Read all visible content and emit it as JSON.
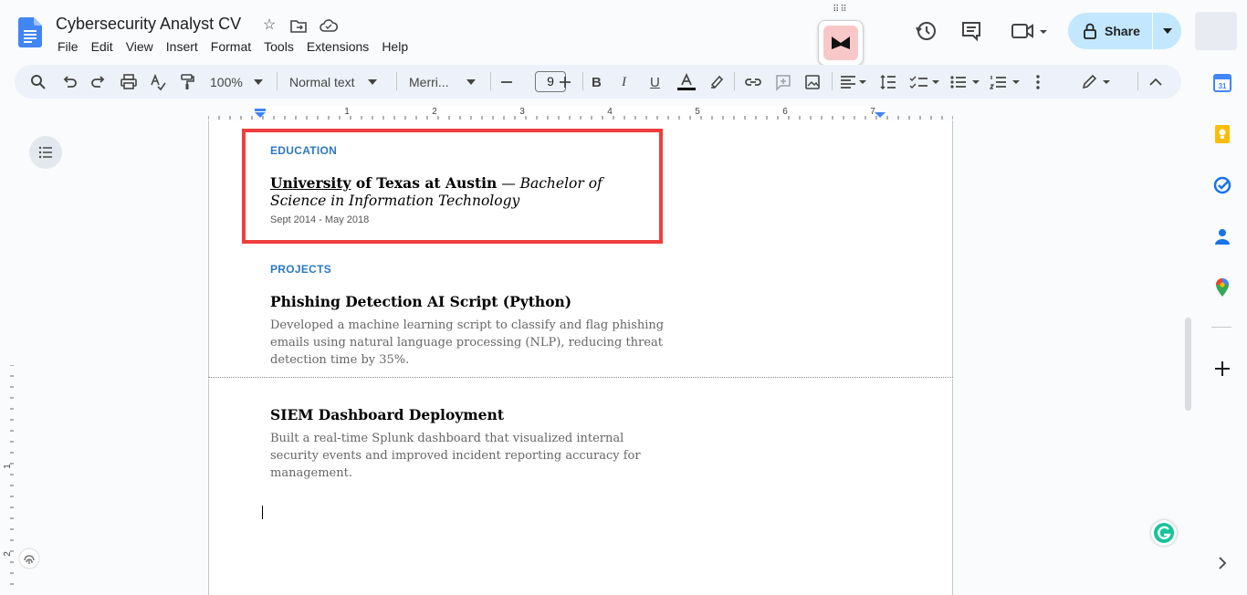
{
  "doc": {
    "title": "Cybersecurity Analyst CV"
  },
  "menu": [
    "File",
    "Edit",
    "View",
    "Insert",
    "Format",
    "Tools",
    "Extensions",
    "Help"
  ],
  "header": {
    "share_label": "Share"
  },
  "toolbar": {
    "zoom": "100%",
    "style": "Normal text",
    "font": "Merri...",
    "font_size": "9"
  },
  "ruler": {
    "marks": [
      "1",
      "2",
      "3",
      "4",
      "5",
      "6",
      "7"
    ]
  },
  "left_ruler": {
    "marks": [
      "1",
      "2"
    ]
  },
  "document": {
    "education_heading": "EDUCATION",
    "university": "University",
    "university_rest": " of Texas at Austin",
    "degree_sep": " — ",
    "degree": "Bachelor of Science in Information Technology",
    "edu_dates": "Sept 2014 - May 2018",
    "projects_heading": "PROJECTS",
    "project1_title": "Phishing Detection AI Script (Python)",
    "project1_desc": "Developed a machine learning script to classify and flag phishing emails using natural language processing (NLP), reducing threat detection time by 35%.",
    "project2_title": "SIEM Dashboard Deployment",
    "project2_desc": "Built a real-time Splunk dashboard that visualized internal security events and improved incident reporting accuracy for management."
  },
  "colors": {
    "accent": "#2b79c2",
    "highlight": "#f03d3d",
    "share_bg": "#c2e7ff"
  }
}
